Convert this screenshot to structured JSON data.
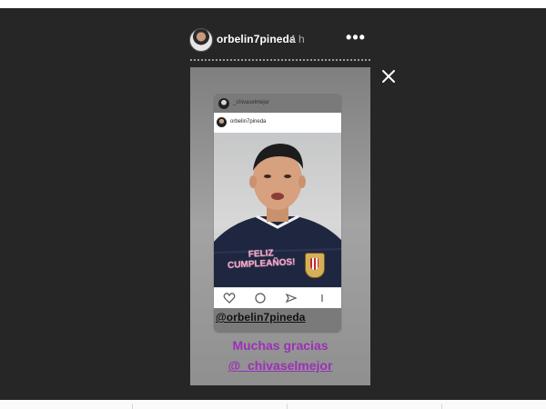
{
  "header": {
    "username": "orbelin7pineda",
    "time": "4 h",
    "more_glyph": "•••",
    "close_icon": "close-icon"
  },
  "story": {
    "repost": {
      "source_user": "_chivaselmejor",
      "post_user": "orbelin7pineda",
      "photo_text_line1": "FELIZ",
      "photo_text_line2": "CUMPLEAÑOS!",
      "mention": "@orbelin7pineda",
      "bottom_icons": [
        "like-icon",
        "comment-icon",
        "share-icon",
        "more-icon"
      ]
    },
    "caption_line1": "Muchas gracias",
    "caption_line2": "@_chivaselmejor"
  },
  "colors": {
    "viewer_bg": "#262626",
    "caption": "#9b30b8",
    "birthday_text": "#f4a3c6",
    "jersey": "#1f2740"
  }
}
